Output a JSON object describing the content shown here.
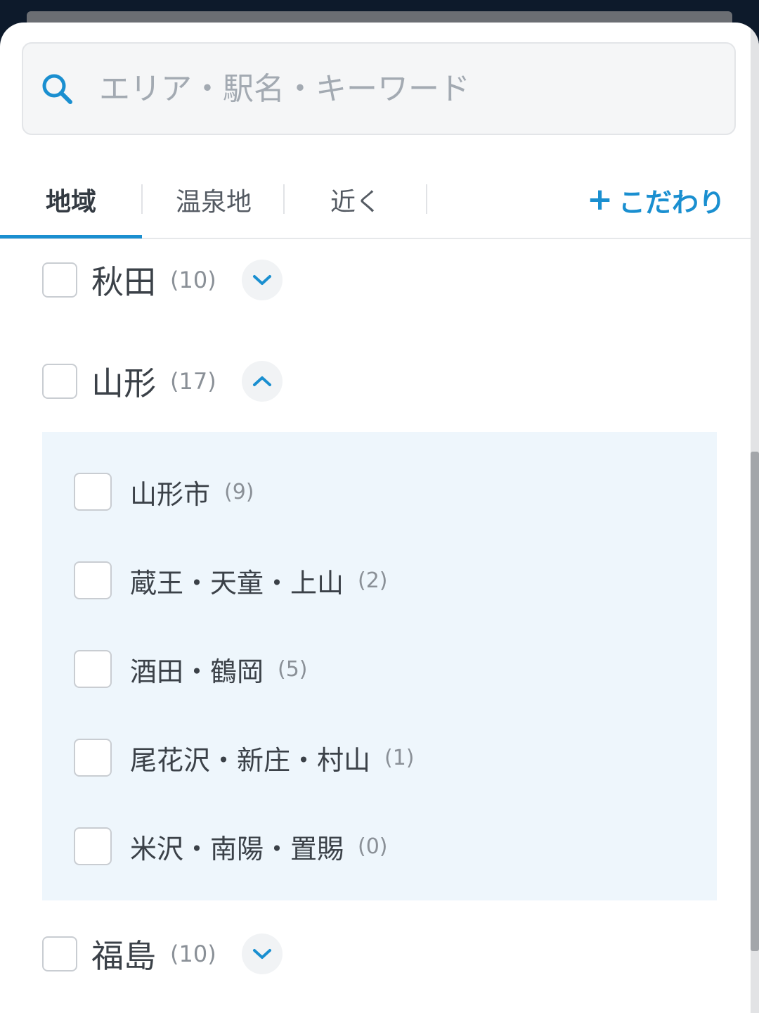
{
  "search": {
    "placeholder": "エリア・駅名・キーワード",
    "value": ""
  },
  "tabs": [
    {
      "label": "地域",
      "active": true
    },
    {
      "label": "温泉地",
      "active": false
    },
    {
      "label": "近く",
      "active": false
    }
  ],
  "kodawari": {
    "plus": "+",
    "label": "こだわり"
  },
  "colors": {
    "accent": "#1a8fd0",
    "subpanel_bg": "#eef6fc"
  },
  "regions": [
    {
      "name": "秋田",
      "count": "(10)",
      "expanded": false,
      "toggle_icon": "chevron-down-icon"
    },
    {
      "name": "山形",
      "count": "(17)",
      "expanded": true,
      "toggle_icon": "chevron-up-icon"
    },
    {
      "name": "福島",
      "count": "(10)",
      "expanded": false,
      "toggle_icon": "chevron-down-icon"
    }
  ],
  "yamagata_subareas": [
    {
      "name": "山形市",
      "count": "(9)"
    },
    {
      "name": "蔵王・天童・上山",
      "count": "(2)"
    },
    {
      "name": "酒田・鶴岡",
      "count": "(5)"
    },
    {
      "name": "尾花沢・新庄・村山",
      "count": "(1)"
    },
    {
      "name": "米沢・南陽・置賜",
      "count": "(0)"
    }
  ]
}
